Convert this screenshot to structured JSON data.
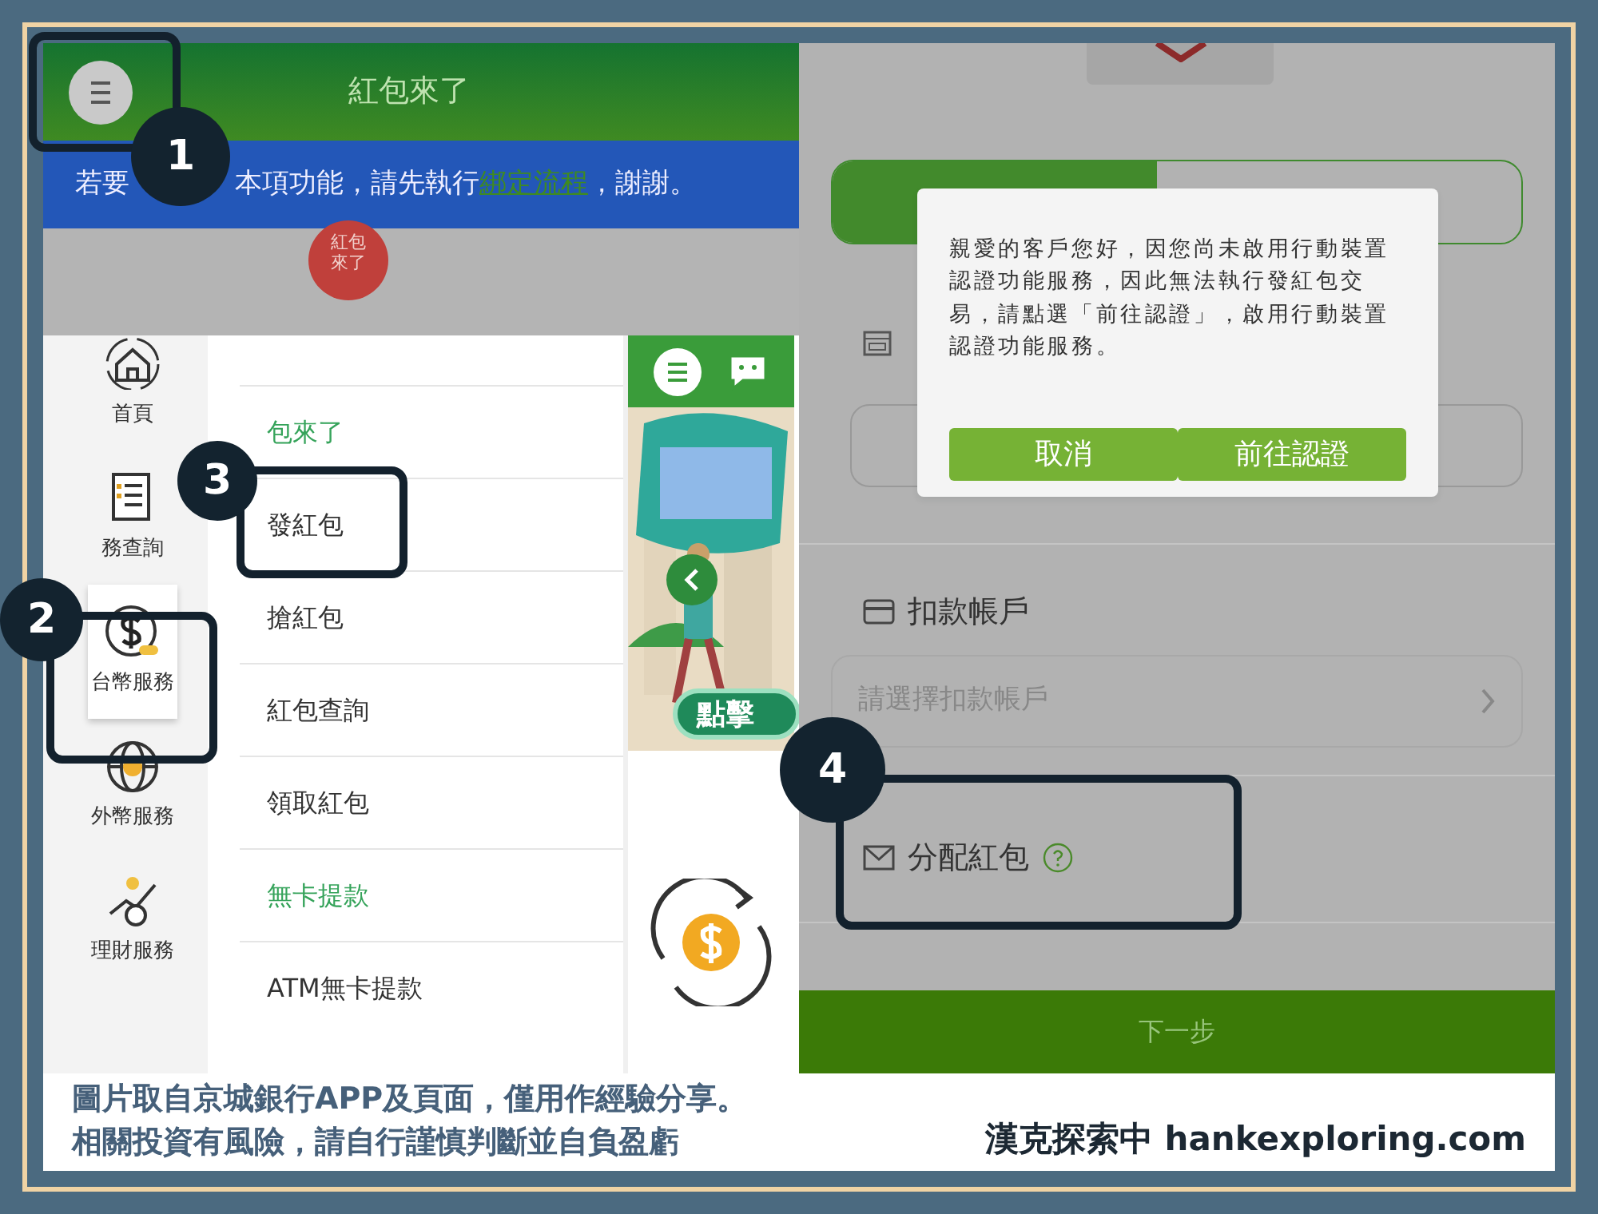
{
  "header": {
    "title": "紅包來了"
  },
  "notice": {
    "lead": "若要",
    "text": "本項功能，請先執行",
    "link": "綁定流程",
    "tail": "，謝謝。"
  },
  "bubble": "紅包來了",
  "sidebar": {
    "items": [
      {
        "label": "首頁",
        "selected": false
      },
      {
        "label": "務查詢",
        "selected": false
      },
      {
        "label": "台幣服務",
        "selected": true
      },
      {
        "label": "外幣服務",
        "selected": false
      },
      {
        "label": "理財服務",
        "selected": false
      }
    ]
  },
  "menu": [
    {
      "kind": "heading",
      "label": "包來了"
    },
    {
      "kind": "item",
      "label": "發紅包"
    },
    {
      "kind": "item",
      "label": "搶紅包"
    },
    {
      "kind": "item",
      "label": "紅包查詢"
    },
    {
      "kind": "item",
      "label": "領取紅包"
    },
    {
      "kind": "heading",
      "label": "無卡提款"
    },
    {
      "kind": "item",
      "label": "ATM無卡提款"
    }
  ],
  "promo": {
    "button": "點擊"
  },
  "progress": {
    "level": 0.47
  },
  "dialog": {
    "message": "親愛的客戶您好，因您尚未啟用行動裝置認證功能服務，因此無法執行發紅包交易，請點選「前往認證」，啟用行動裝置認證功能服務。",
    "buttons": [
      "取消",
      "前往認證"
    ]
  },
  "account": {
    "label": "扣款帳戶",
    "placeholder": "請選擇扣款帳戶"
  },
  "allocate": {
    "label": "分配紅包"
  },
  "next_button": "下一步",
  "steps": [
    "1",
    "2",
    "3",
    "4"
  ],
  "caption": {
    "lines": [
      "圖片取自京城銀行APP及頁面，僅用作經驗分享。",
      "相關投資有風險，請自行謹慎判斷並自負盈虧"
    ],
    "credit": "漢克探索中 hankexploring.com"
  }
}
